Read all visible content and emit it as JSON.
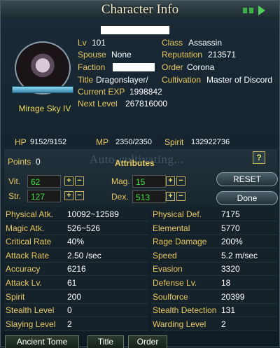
{
  "window": {
    "title": "Character Info"
  },
  "profile": {
    "name": "Mirage Sky IV",
    "level_label": "Lv",
    "level": "101",
    "spouse_label": "Spouse",
    "spouse": "None",
    "faction_label": "Faction",
    "title_label": "Title",
    "title": "Dragonslayer/",
    "exp_label": "Current EXP",
    "exp": "1998842",
    "next_label": "Next Level",
    "next": "267816000",
    "class_label": "Class",
    "class": "Assassin",
    "reputation_label": "Reputation",
    "reputation": "213571",
    "order_label": "Order",
    "order": "Corona",
    "cultivation_label": "Cultivation",
    "cultivation": "Master of Discord"
  },
  "vitals": {
    "hp_label": "HP",
    "hp": "9152/9152",
    "mp_label": "MP",
    "mp": "2350/2350",
    "spirit_label": "Spirit",
    "spirit": "132922736"
  },
  "attributes": {
    "points_label": "Points",
    "points": "0",
    "header": "Attributes",
    "watermark": "Auto-cultivating...",
    "vit_label": "Vit.",
    "vit": "62",
    "str_label": "Str.",
    "str": "127",
    "mag_label": "Mag.",
    "mag": "15",
    "dex_label": "Dex.",
    "dex": "513",
    "reset_label": "RESET",
    "done_label": "Done",
    "help_label": "?"
  },
  "stats": [
    {
      "k": "Physical Atk.",
      "v": "10092~12589"
    },
    {
      "k": "Physical Def.",
      "v": "7175"
    },
    {
      "k": "Magic Atk.",
      "v": "526~526"
    },
    {
      "k": "Elemental",
      "v": "5770"
    },
    {
      "k": "Critical Rate",
      "v": "40%"
    },
    {
      "k": "Rage Damage",
      "v": "200%"
    },
    {
      "k": "Attack Rate",
      "v": "2.50 /sec"
    },
    {
      "k": "Speed",
      "v": "5.2 m/sec"
    },
    {
      "k": "Accuracy",
      "v": "6216"
    },
    {
      "k": "Evasion",
      "v": "3320"
    },
    {
      "k": "Attack Lv.",
      "v": "61"
    },
    {
      "k": "Defense Lv.",
      "v": "18"
    },
    {
      "k": "Spirit",
      "v": "200"
    },
    {
      "k": "Soulforce",
      "v": "20399"
    },
    {
      "k": "Stealth Level",
      "v": "0"
    },
    {
      "k": "Stealth Detection",
      "v": "131"
    },
    {
      "k": "Slaying Level",
      "v": "2"
    },
    {
      "k": "Warding Level",
      "v": "2"
    }
  ],
  "tabs": [
    "Ancient Tome",
    "Title",
    "Order"
  ]
}
